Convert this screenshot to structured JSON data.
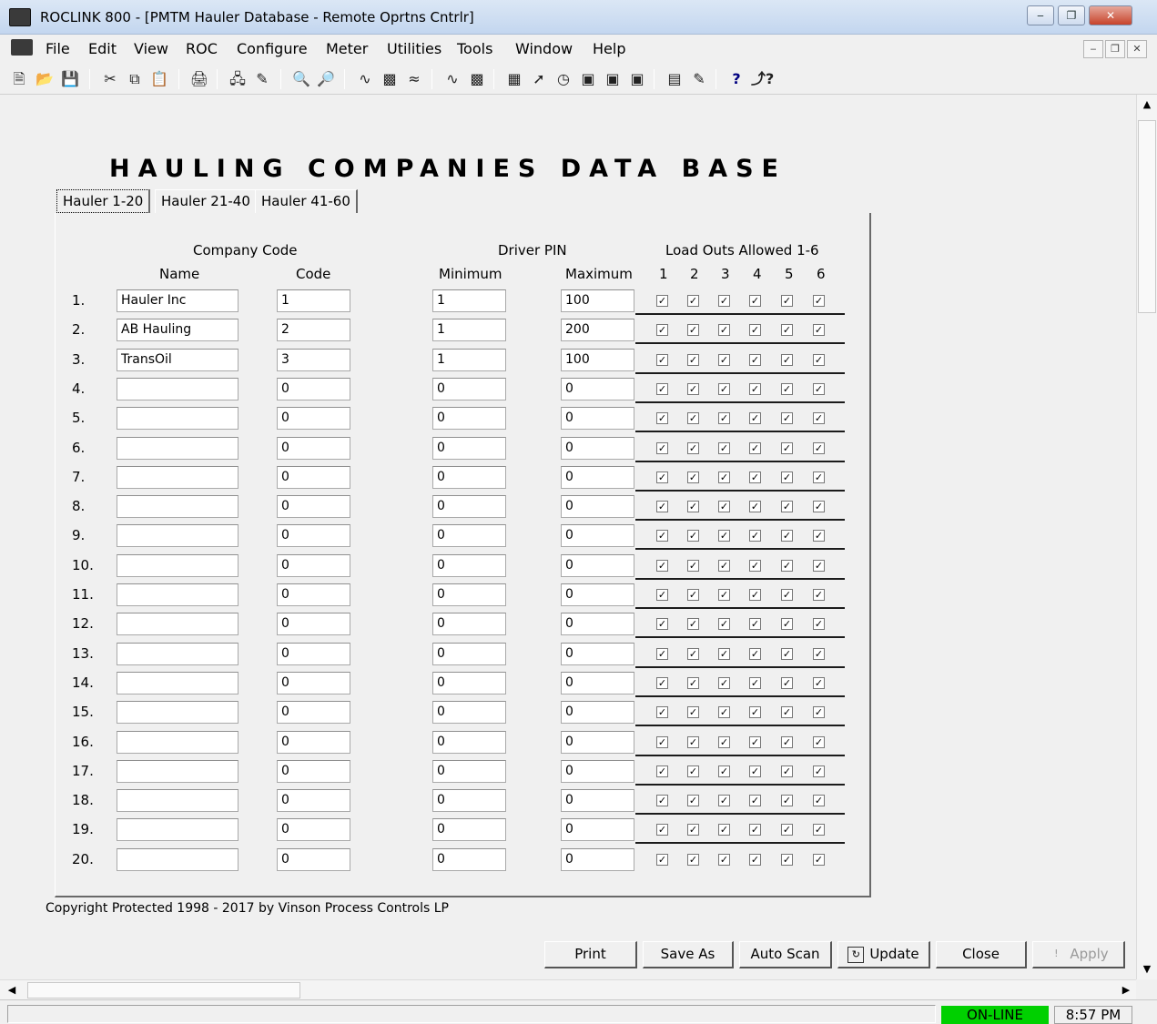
{
  "window": {
    "title": "ROCLINK 800 - [PMTM Hauler Database - Remote Oprtns Cntrlr]",
    "minimize": "‒",
    "restore": "❐",
    "close": "✕"
  },
  "menu": [
    "File",
    "Edit",
    "View",
    "ROC",
    "Configure",
    "Meter",
    "Utilities",
    "Tools",
    "Window",
    "Help"
  ],
  "mdi_buttons": [
    "‒",
    "❐",
    "✕"
  ],
  "toolbar_icons": [
    "new-icon",
    "open-icon",
    "save-icon",
    "cut-icon",
    "copy-icon",
    "paste-icon",
    "print-icon",
    "connect-icon",
    "device-directory-icon",
    "zoom-in-icon",
    "zoom-out-icon",
    "trend-icon",
    "alarm-log-icon",
    "event-log-icon",
    "history-icon",
    "weekly-icon",
    "display-icon",
    "flash-icon",
    "clock-icon",
    "tlp-icon",
    "monitor-icon",
    "security-icon",
    "plot-icon",
    "notes-icon",
    "help-icon",
    "whats-this-icon"
  ],
  "heading": "HAULING COMPANIES DATA BASE",
  "tabs": [
    "Hauler 1-20",
    "Hauler 21-40",
    "Hauler 41-60"
  ],
  "columns": {
    "company_code": "Company Code",
    "name": "Name",
    "code": "Code",
    "driver_pin": "Driver PIN",
    "minimum": "Minimum",
    "maximum": "Maximum",
    "load_outs": "Load Outs Allowed 1-6",
    "load_out_nums": [
      "1",
      "2",
      "3",
      "4",
      "5",
      "6"
    ]
  },
  "rows": [
    {
      "num": "1.",
      "name": "Hauler Inc",
      "code": "1",
      "min": "1",
      "max": "100"
    },
    {
      "num": "2.",
      "name": "AB Hauling",
      "code": "2",
      "min": "1",
      "max": "200"
    },
    {
      "num": "3.",
      "name": "TransOil",
      "code": "3",
      "min": "1",
      "max": "100"
    },
    {
      "num": "4.",
      "name": "",
      "code": "0",
      "min": "0",
      "max": "0"
    },
    {
      "num": "5.",
      "name": "",
      "code": "0",
      "min": "0",
      "max": "0"
    },
    {
      "num": "6.",
      "name": "",
      "code": "0",
      "min": "0",
      "max": "0"
    },
    {
      "num": "7.",
      "name": "",
      "code": "0",
      "min": "0",
      "max": "0"
    },
    {
      "num": "8.",
      "name": "",
      "code": "0",
      "min": "0",
      "max": "0"
    },
    {
      "num": "9.",
      "name": "",
      "code": "0",
      "min": "0",
      "max": "0"
    },
    {
      "num": "10.",
      "name": "",
      "code": "0",
      "min": "0",
      "max": "0"
    },
    {
      "num": "11.",
      "name": "",
      "code": "0",
      "min": "0",
      "max": "0"
    },
    {
      "num": "12.",
      "name": "",
      "code": "0",
      "min": "0",
      "max": "0"
    },
    {
      "num": "13.",
      "name": "",
      "code": "0",
      "min": "0",
      "max": "0"
    },
    {
      "num": "14.",
      "name": "",
      "code": "0",
      "min": "0",
      "max": "0"
    },
    {
      "num": "15.",
      "name": "",
      "code": "0",
      "min": "0",
      "max": "0"
    },
    {
      "num": "16.",
      "name": "",
      "code": "0",
      "min": "0",
      "max": "0"
    },
    {
      "num": "17.",
      "name": "",
      "code": "0",
      "min": "0",
      "max": "0"
    },
    {
      "num": "18.",
      "name": "",
      "code": "0",
      "min": "0",
      "max": "0"
    },
    {
      "num": "19.",
      "name": "",
      "code": "0",
      "min": "0",
      "max": "0"
    },
    {
      "num": "20.",
      "name": "",
      "code": "0",
      "min": "0",
      "max": "0"
    }
  ],
  "checkmark": "✓",
  "copyright": "Copyright Protected 1998 - 2017 by Vinson Process Controls LP",
  "buttons": {
    "print": "Print",
    "save_as": "Save As",
    "auto_scan": "Auto Scan",
    "update": "Update",
    "close": "Close",
    "apply": "Apply"
  },
  "status": {
    "online": "ON-LINE",
    "time": "8:57 PM",
    "online_color": "#00d000"
  }
}
